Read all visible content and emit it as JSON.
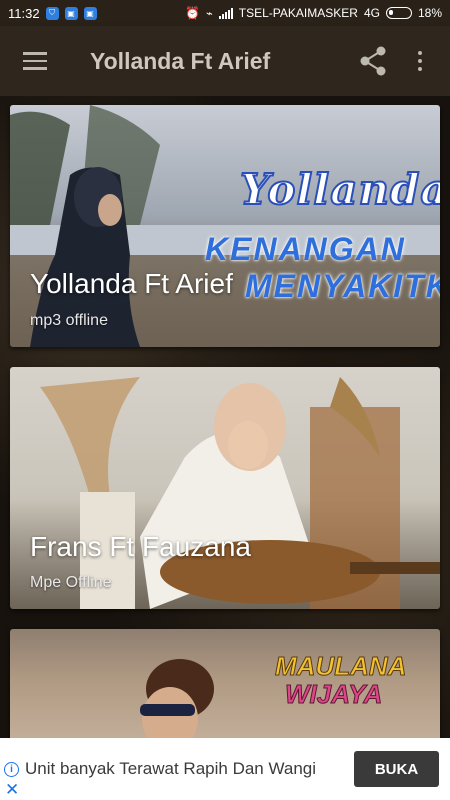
{
  "status_bar": {
    "time": "11:32",
    "carrier": "TSEL-PAKAIMASKER",
    "network": "4G",
    "battery": "18%"
  },
  "toolbar": {
    "title": "Yollanda Ft Arief",
    "menu_icon": "hamburger-menu-icon",
    "share_icon": "share-icon",
    "more_icon": "more-vert-icon"
  },
  "cards": [
    {
      "title": "Yollanda Ft Arief",
      "subtitle": "mp3 offline",
      "art_lines": [
        "Yollanda",
        "KENANGAN",
        "MENYAKITKAN"
      ]
    },
    {
      "title": "Frans Ft Fauzana",
      "subtitle": "Mpe Offline"
    },
    {
      "art_lines": [
        "MAULANA",
        "WIJAYA"
      ]
    }
  ],
  "ad": {
    "text": "Unit banyak Terawat Rapih Dan Wangi",
    "button": "BUKA",
    "info_icon": "info-icon",
    "close_icon": "close-icon"
  },
  "colors": {
    "toolbar_bg": "#2f271d",
    "status_bg": "#2a2219",
    "ad_button": "#3a3a3a",
    "ad_accent": "#1a73e8"
  }
}
